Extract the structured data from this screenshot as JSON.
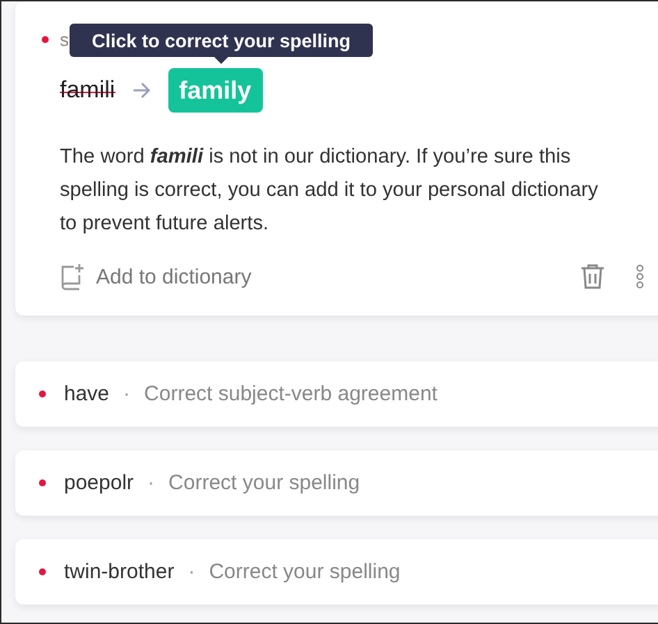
{
  "active_alert": {
    "category": "s",
    "tooltip": "Click to correct your spelling",
    "original": "famili",
    "suggestion": "family",
    "explanation": "The word *famili* is not in our dictionary. If you’re sure this spelling is correct, you can add it to your personal dictionary to prevent future alerts.",
    "action": "Add to dictionary",
    "color": "#e5173f"
  },
  "alerts": [
    {
      "word": "have",
      "separator": "·",
      "description": "Correct subject-verb agreement",
      "color": "#e5173f"
    },
    {
      "word": "poepolr",
      "separator": "·",
      "description": "Correct your spelling",
      "color": "#e5173f"
    },
    {
      "word": "twin-brother",
      "separator": "·",
      "description": "Correct your spelling",
      "color": "#e5173f"
    }
  ]
}
